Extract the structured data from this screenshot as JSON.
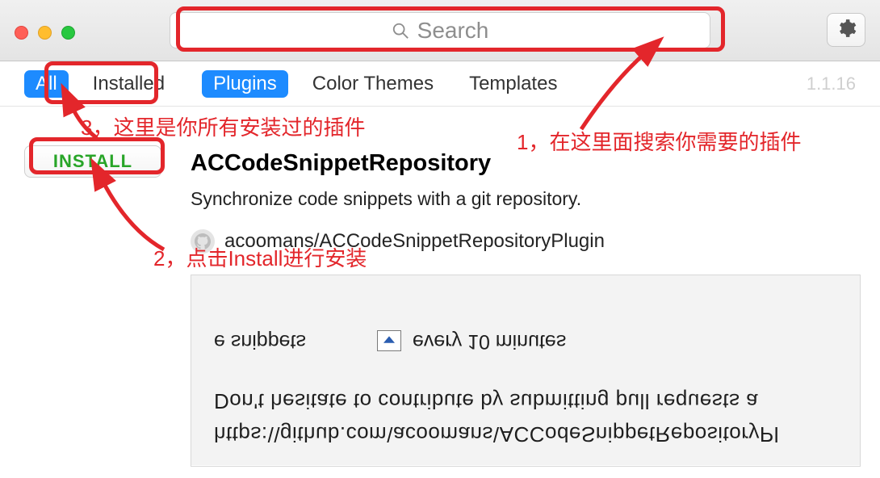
{
  "titlebar": {
    "search_placeholder": "Search"
  },
  "tabs": {
    "all": "All",
    "installed": "Installed",
    "plugins": "Plugins",
    "color_themes": "Color Themes",
    "templates": "Templates"
  },
  "version": "1.1.16",
  "install_button_label": "INSTALL",
  "plugin": {
    "title": "ACCodeSnippetRepository",
    "description": "Synchronize code snippets with a git repository.",
    "repo": "acoomans/ACCodeSnippetRepositoryPlugin"
  },
  "preview": {
    "url": "https:\\\\github.com\\acoomans\\ACCodeSnippetRepositoryPl",
    "contrib": "Don't hesitate to contribute by submitting pull requests a",
    "snippets_fragment": "e snippets",
    "interval": "every 10 minutes"
  },
  "annotations": {
    "a1": "1，在这里面搜索你需要的插件",
    "a2": "2，点击Install进行安装",
    "a3": "3，这里是你所有安装过的插件"
  }
}
